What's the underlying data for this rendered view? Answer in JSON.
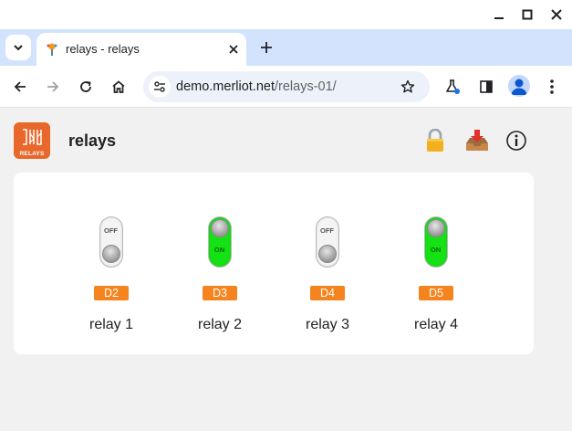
{
  "window": {
    "controls": [
      "minimize-icon",
      "maximize-icon",
      "close-icon"
    ]
  },
  "tab": {
    "title": "relays - relays",
    "favicon": "merliot-favicon"
  },
  "toolbar": {
    "url_host": "demo.merliot.net",
    "url_path": "/relays-01/",
    "icons": [
      "back-icon",
      "forward-icon",
      "reload-icon",
      "home-icon",
      "site-info-icon",
      "bookmark-star-icon",
      "labs-flask-icon",
      "side-panel-icon",
      "profile-avatar-icon",
      "more-menu-icon"
    ]
  },
  "app": {
    "logo_text": "RELAYS",
    "title": "relays",
    "header_icons": [
      "lock-icon",
      "download-icon",
      "info-icon"
    ],
    "info_glyph": "ⓘ",
    "lock_glyph": "🔒",
    "download_glyph": "📥"
  },
  "relays": [
    {
      "name": "relay 1",
      "pin": "D2",
      "state": "OFF"
    },
    {
      "name": "relay 2",
      "pin": "D3",
      "state": "ON"
    },
    {
      "name": "relay 3",
      "pin": "D4",
      "state": "OFF"
    },
    {
      "name": "relay 4",
      "pin": "D5",
      "state": "ON"
    }
  ],
  "colors": {
    "accent_orange": "#f5841f",
    "switch_on": "#14e214",
    "logo_bg": "#e8672a",
    "tabstrip": "#d3e3fd"
  }
}
